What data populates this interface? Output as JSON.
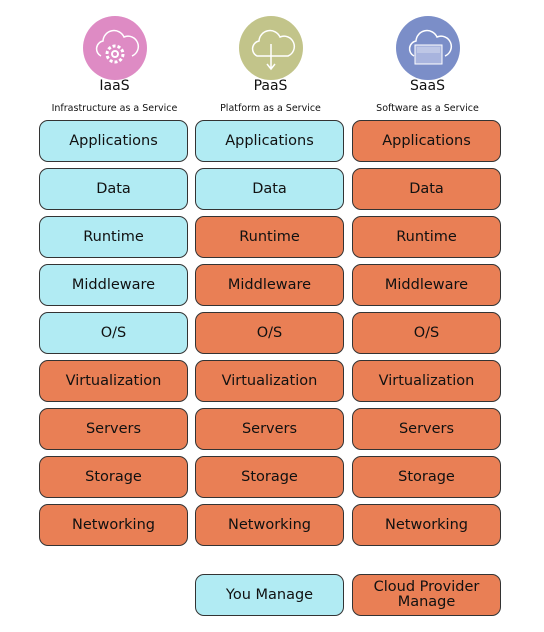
{
  "colors": {
    "you": "#b1ebf3",
    "cloud": "#e97f55",
    "iaas": "#de8bc4",
    "paas": "#c2c48a",
    "saas": "#7b8ec8"
  },
  "columns": [
    {
      "title": "IaaS",
      "subtitle": "Infrastructure as a Service",
      "icon": "cloud-gear-icon",
      "layers": [
        {
          "label": "Applications",
          "managed": "you"
        },
        {
          "label": "Data",
          "managed": "you"
        },
        {
          "label": "Runtime",
          "managed": "you"
        },
        {
          "label": "Middleware",
          "managed": "you"
        },
        {
          "label": "O/S",
          "managed": "you"
        },
        {
          "label": "Virtualization",
          "managed": "cloud"
        },
        {
          "label": "Servers",
          "managed": "cloud"
        },
        {
          "label": "Storage",
          "managed": "cloud"
        },
        {
          "label": "Networking",
          "managed": "cloud"
        }
      ]
    },
    {
      "title": "PaaS",
      "subtitle": "Platform as a Service",
      "icon": "cloud-download-icon",
      "layers": [
        {
          "label": "Applications",
          "managed": "you"
        },
        {
          "label": "Data",
          "managed": "you"
        },
        {
          "label": "Runtime",
          "managed": "cloud"
        },
        {
          "label": "Middleware",
          "managed": "cloud"
        },
        {
          "label": "O/S",
          "managed": "cloud"
        },
        {
          "label": "Virtualization",
          "managed": "cloud"
        },
        {
          "label": "Servers",
          "managed": "cloud"
        },
        {
          "label": "Storage",
          "managed": "cloud"
        },
        {
          "label": "Networking",
          "managed": "cloud"
        }
      ]
    },
    {
      "title": "SaaS",
      "subtitle": "Software as a Service",
      "icon": "cloud-window-icon",
      "layers": [
        {
          "label": "Applications",
          "managed": "cloud"
        },
        {
          "label": "Data",
          "managed": "cloud"
        },
        {
          "label": "Runtime",
          "managed": "cloud"
        },
        {
          "label": "Middleware",
          "managed": "cloud"
        },
        {
          "label": "O/S",
          "managed": "cloud"
        },
        {
          "label": "Virtualization",
          "managed": "cloud"
        },
        {
          "label": "Servers",
          "managed": "cloud"
        },
        {
          "label": "Storage",
          "managed": "cloud"
        },
        {
          "label": "Networking",
          "managed": "cloud"
        }
      ]
    }
  ],
  "legend": {
    "you": "You Manage",
    "cloud": "Cloud Provider Manage"
  }
}
